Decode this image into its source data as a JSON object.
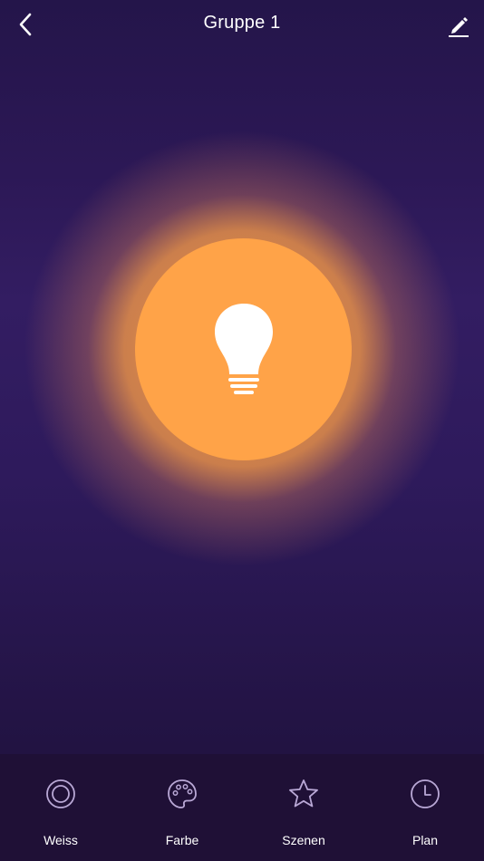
{
  "header": {
    "title": "Gruppe 1",
    "back_icon": "chevron-left-icon",
    "edit_icon": "pencil-icon"
  },
  "lamp": {
    "icon": "lightbulb-icon",
    "state": "on",
    "color": "#ffa348"
  },
  "tabs": [
    {
      "label": "Weiss",
      "icon": "circle-ring-icon"
    },
    {
      "label": "Farbe",
      "icon": "palette-icon"
    },
    {
      "label": "Szenen",
      "icon": "star-icon"
    },
    {
      "label": "Plan",
      "icon": "clock-icon"
    }
  ],
  "colors": {
    "background": "#2c1856",
    "tabbar": "#1f1036",
    "accent": "#ffa348",
    "icon_inactive": "#b9a8d6"
  }
}
